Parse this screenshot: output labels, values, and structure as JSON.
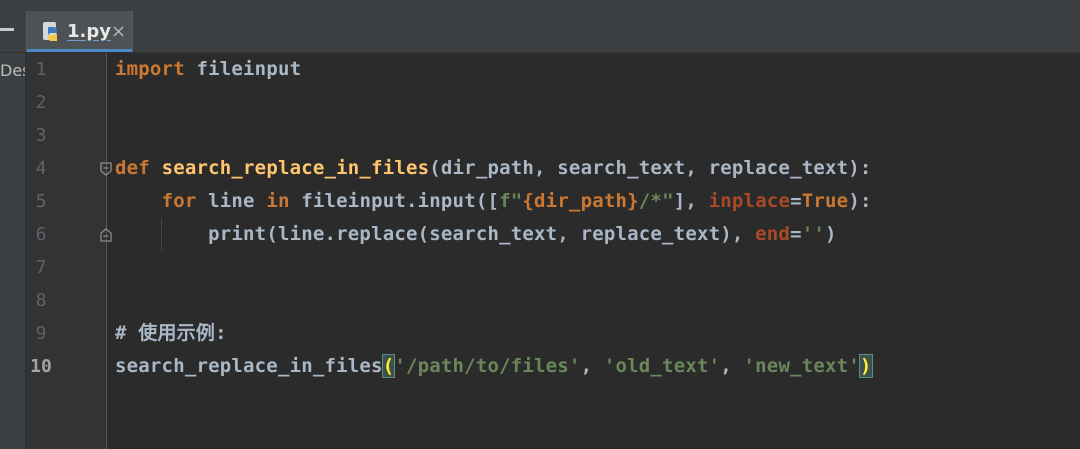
{
  "tab": {
    "filename": "1.py",
    "close": "×"
  },
  "side_panel": {
    "label": "Des"
  },
  "gutter": {
    "line_numbers": [
      "1",
      "2",
      "3",
      "4",
      "5",
      "6",
      "7",
      "8",
      "9",
      "10"
    ],
    "current_line": "10"
  },
  "code": {
    "line1": {
      "kw": "import",
      "rest": " fileinput"
    },
    "line4": {
      "kw": "def",
      "space": " ",
      "fn": "search_replace_in_files",
      "args": "(dir_path, search_text, replace_text):"
    },
    "line5": {
      "indent": "    ",
      "kw_for": "for",
      "p1": " line ",
      "kw_in": "in",
      "p2": " fileinput.input([",
      "fstr_open": "f\"",
      "fexpr": "{dir_path}",
      "fstr_close": "/*\"",
      "p3": "], ",
      "kwarg": "inplace",
      "eq": "=",
      "true": "True",
      "p4": "):"
    },
    "line6": {
      "indent": "        ",
      "p1": "print(line.replace(search_text, replace_text), ",
      "kwarg": "end",
      "eq": "=",
      "str": "''",
      "p2": ")"
    },
    "line9": {
      "comment": "# 使用示例:"
    },
    "line10": {
      "fn_call": "search_replace_in_files",
      "open": "(",
      "s1": "'/path/to/files'",
      "c1": ", ",
      "s2": "'old_text'",
      "c2": ", ",
      "s3": "'new_text'",
      "close": ")"
    }
  },
  "colors": {
    "keyword": "#cc7832",
    "string": "#6a8759",
    "function": "#ffc66d",
    "text": "#a9b7c6",
    "background": "#2b2b2b"
  }
}
